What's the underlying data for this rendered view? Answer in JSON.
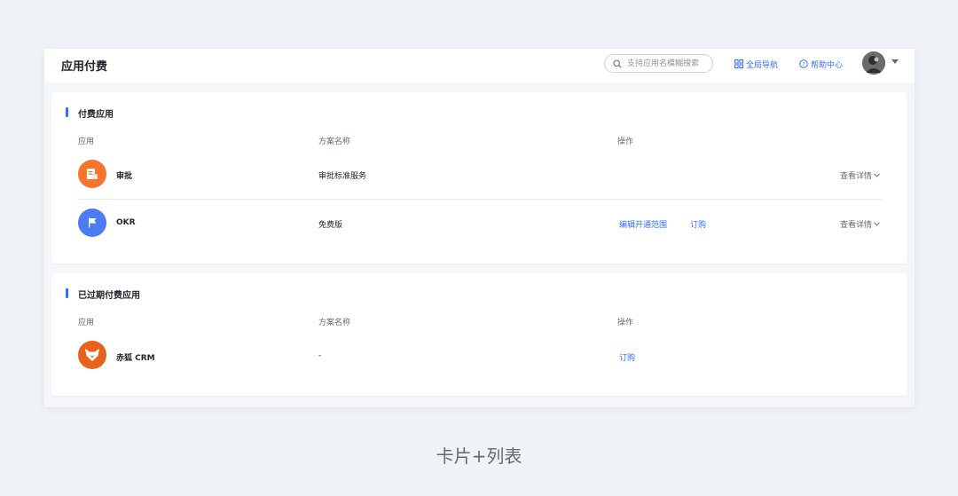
{
  "header": {
    "title": "应用付费",
    "search": {
      "placeholder": "支持应用名模糊搜索",
      "value": ""
    },
    "global_nav_label": "全局导航",
    "help_label": "帮助中心"
  },
  "paid_apps": {
    "title": "付费应用",
    "columns": {
      "app": "应用",
      "plan": "方案名称",
      "actions": "操作"
    },
    "rows": [
      {
        "name": "审批",
        "plan": "审批标准服务",
        "icon": "approval-icon",
        "color": "#f5752b",
        "actions": [],
        "detail_label": "查看详情"
      },
      {
        "name": "OKR",
        "plan": "免费版",
        "icon": "flag-icon",
        "color": "#4c7bf3",
        "actions": [
          "编辑开通范围",
          "订购"
        ],
        "detail_label": "查看详情"
      }
    ]
  },
  "expired_apps": {
    "title": "已过期付费应用",
    "columns": {
      "app": "应用",
      "plan": "方案名称",
      "actions": "操作"
    },
    "rows": [
      {
        "name": "赤狐 CRM",
        "plan": "-",
        "icon": "fox-icon",
        "color": "#e8621d",
        "actions": [
          "订购"
        ]
      }
    ]
  },
  "caption": "卡片+列表",
  "colors": {
    "accent": "#3370ff",
    "background": "#eff2f6"
  }
}
